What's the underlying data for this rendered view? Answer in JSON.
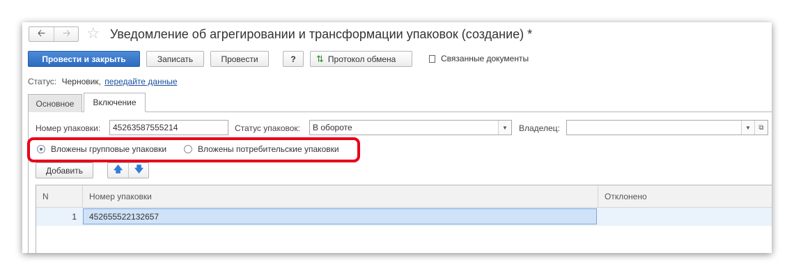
{
  "window": {
    "title": "Уведомление об агрегировании и трансформации упаковок (создание) *"
  },
  "toolbar": {
    "post_close": "Провести и закрыть",
    "save": "Записать",
    "post": "Провести",
    "help": "?",
    "protocol": "Протокол обмена",
    "related": "Связанные документы"
  },
  "status": {
    "label": "Статус:",
    "value": "Черновик,",
    "link": "передайте данные"
  },
  "tabs": [
    {
      "label": "Основное"
    },
    {
      "label": "Включение"
    }
  ],
  "form": {
    "package_number_label": "Номер упаковки:",
    "package_number_value": "45263587555214",
    "package_status_label": "Статус упаковок:",
    "package_status_value": "В обороте",
    "owner_label": "Владелец:",
    "owner_value": ""
  },
  "radio": {
    "group": "Вложены групповые упаковки",
    "consumer": "Вложены потребительские упаковки",
    "selected": "group"
  },
  "list_toolbar": {
    "add": "Добавить"
  },
  "table": {
    "columns": [
      "N",
      "Номер упаковки",
      "Отклонено"
    ],
    "rows": [
      {
        "n": "1",
        "number": "452655522132657",
        "rejected": ""
      }
    ]
  },
  "colors": {
    "highlight": "#e8001c",
    "primary": "#2c6bbf",
    "selected_row": "#cfe2f7"
  },
  "icons": [
    "back-arrow-icon",
    "forward-arrow-icon",
    "star-icon",
    "sync-icon",
    "document-icon",
    "arrow-up-icon",
    "arrow-down-icon",
    "open-icon"
  ]
}
